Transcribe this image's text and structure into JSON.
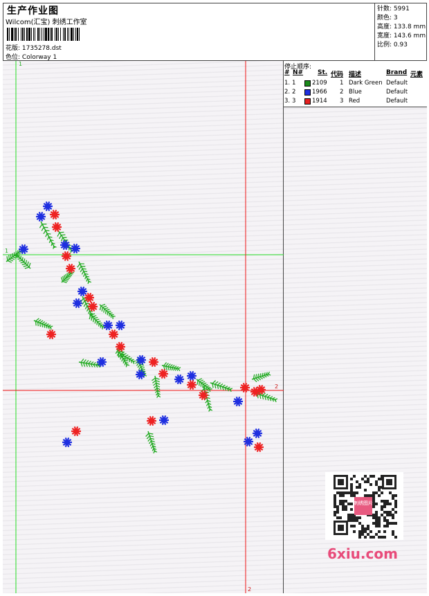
{
  "header": {
    "title": "生产作业图",
    "company": "Wilcom(汇宝) 刺绣工作室",
    "design_label": "花版:",
    "design_value": "1735278.dst",
    "colorway_label": "色位:",
    "colorway_value": "Colorway 1"
  },
  "stats": [
    {
      "label": "针数:",
      "value": "5991"
    },
    {
      "label": "颜色:",
      "value": "3"
    },
    {
      "label": "高度:",
      "value": "133.8 mm"
    },
    {
      "label": "宽度:",
      "value": "143.6 mm"
    },
    {
      "label": "比例:",
      "value": "0.93"
    }
  ],
  "canvas": {
    "axis_marks": {
      "green_top": "1",
      "green_left": "1",
      "red_right": "2",
      "red_bottom": "2"
    },
    "colors": {
      "green_line": "#22dd22",
      "red_line": "#ee1111",
      "thread_green": "#22aa22",
      "thread_blue": "#1f2fe0",
      "thread_red": "#ee2222"
    }
  },
  "stop_sequence": {
    "title": "停止顺序:",
    "headers": {
      "num": "#",
      "n": "N#",
      "st": "St.",
      "code": "代码",
      "desc": "描述",
      "brand": "Brand",
      "element": "元素"
    },
    "rows": [
      {
        "num": "1.",
        "n": "1",
        "color": "#1a8a1a",
        "st": "2109",
        "code": "1",
        "desc": "Dark Green",
        "brand": "Default"
      },
      {
        "num": "2.",
        "n": "2",
        "color": "#1f2fe0",
        "st": "1966",
        "code": "2",
        "desc": "Blue",
        "brand": "Default"
      },
      {
        "num": "3.",
        "n": "3",
        "color": "#e62020",
        "st": "1914",
        "code": "3",
        "desc": "Red",
        "brand": "Default"
      }
    ]
  },
  "watermark": "6xiu.com",
  "qr_label": "刺绣图片"
}
